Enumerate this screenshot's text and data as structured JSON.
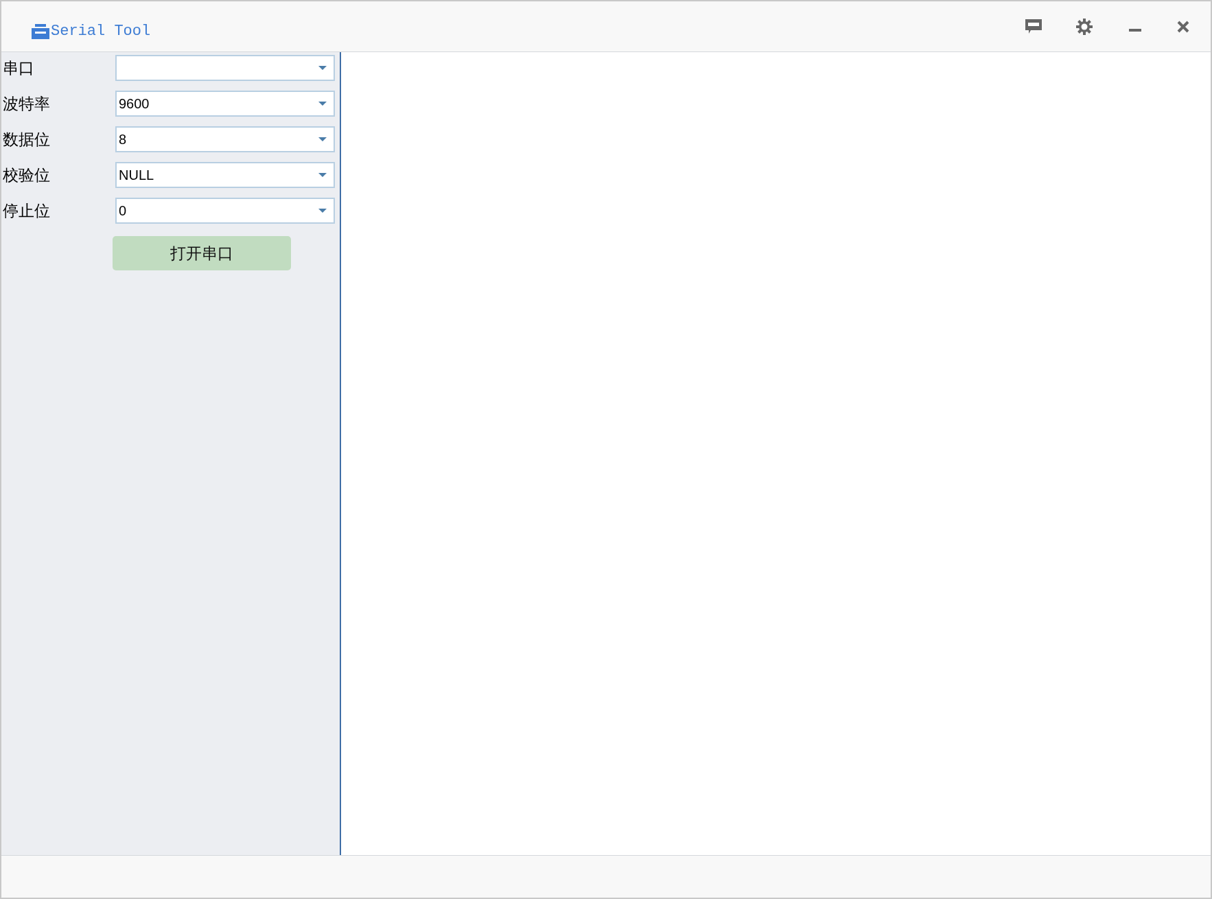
{
  "window": {
    "title": "Serial Tool"
  },
  "settings": [
    {
      "label": "串口"
    },
    {
      "label": "波特率",
      "value": "9600"
    },
    {
      "label": "数据位",
      "value": "8"
    },
    {
      "label": "校验位",
      "value": "NULL"
    },
    {
      "label": "停止位",
      "value": "0"
    }
  ],
  "open_button": "打开串口"
}
